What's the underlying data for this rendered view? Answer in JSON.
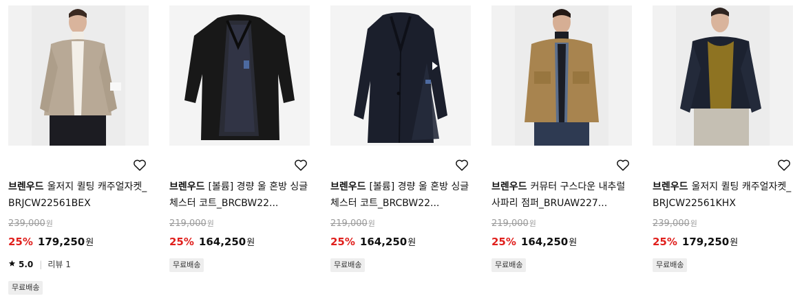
{
  "products": [
    {
      "brand": "브렌우드",
      "name": "울저지 퀼팅 캐주얼자켓_BRJCW22561BEX",
      "original_price": "239,000",
      "original_unit": "원",
      "discount_rate": "25%",
      "sale_price": "179,250",
      "sale_unit": "원",
      "rating_score": "5.0",
      "review_label": "리뷰 1",
      "badge": "무료배송",
      "image_icon": "beige-jacket-model-photo"
    },
    {
      "brand": "브렌우드",
      "name": "[볼륨] 경량 울 혼방 싱글 체스터 코트_BRCBW22...",
      "original_price": "219,000",
      "original_unit": "원",
      "discount_rate": "25%",
      "sale_price": "164,250",
      "sale_unit": "원",
      "badge": "무료배송",
      "image_icon": "black-coat-open-photo"
    },
    {
      "brand": "브렌우드",
      "name": "[볼륨] 경량 울 혼방 싱글 체스터 코트_BRCBW22...",
      "original_price": "219,000",
      "original_unit": "원",
      "discount_rate": "25%",
      "sale_price": "164,250",
      "sale_unit": "원",
      "badge": "무료배송",
      "image_icon": "navy-coat-photo"
    },
    {
      "brand": "브렌우드",
      "name": "커뮤터 구스다운 내추럴 사파리 점퍼_BRUAW227...",
      "original_price": "219,000",
      "original_unit": "원",
      "discount_rate": "25%",
      "sale_price": "164,250",
      "sale_unit": "원",
      "badge": "무료배송",
      "image_icon": "camel-safari-jumper-model-photo"
    },
    {
      "brand": "브렌우드",
      "name": "울저지 퀼팅 캐주얼자켓_BRJCW22561KHX",
      "original_price": "239,000",
      "original_unit": "원",
      "discount_rate": "25%",
      "sale_price": "179,250",
      "sale_unit": "원",
      "badge": "무료배송",
      "image_icon": "navy-quilted-jacket-model-photo"
    }
  ],
  "colors": {
    "discount": "#e0201d",
    "original_price": "#9a9a9a",
    "badge_bg": "#eeeeee"
  }
}
